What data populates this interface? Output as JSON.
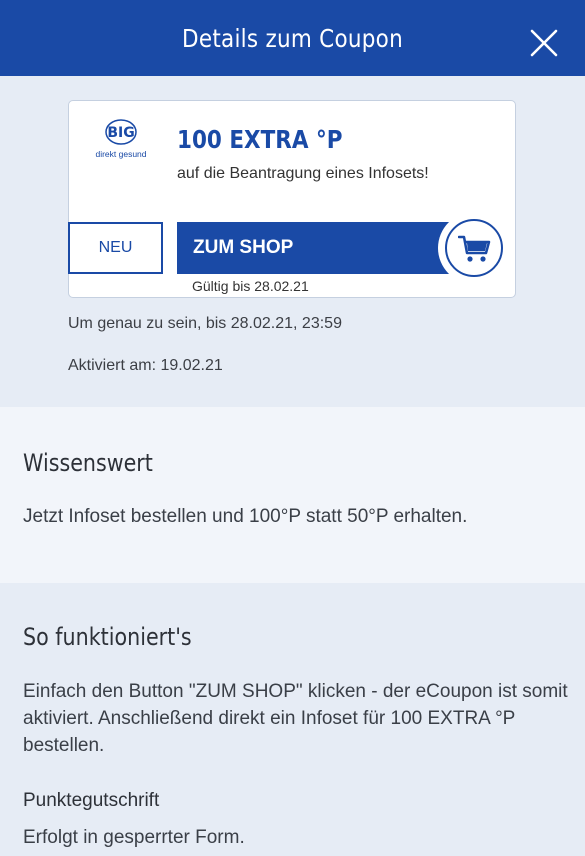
{
  "header": {
    "title": "Details zum Coupon"
  },
  "coupon": {
    "logo_text": "BIG",
    "logo_sub": "direkt gesund",
    "title": "100 EXTRA °P",
    "description": "auf die Beantragung eines Infosets!",
    "neu_label": "NEU",
    "shop_label": "ZUM SHOP",
    "valid_until": "Gültig bis 28.02.21"
  },
  "info": {
    "precise": "Um genau zu sein, bis 28.02.21, 23:59",
    "activated": "Aktiviert am: 19.02.21"
  },
  "wissenswert": {
    "title": "Wissenswert",
    "text": "Jetzt Infoset bestellen und 100°P statt 50°P erhalten."
  },
  "funktioniert": {
    "title": "So funktioniert's",
    "text": "Einfach den Button \"ZUM SHOP\" klicken - der eCoupon ist somit aktiviert. Anschließend direkt ein Infoset für 100 EXTRA °P bestellen.",
    "sub_title": "Punktegutschrift",
    "sub_text": "Erfolgt in gesperrter Form."
  },
  "colors": {
    "brand": "#1a4aa6",
    "background": "#e6ecf5",
    "section": "#f2f5fa"
  }
}
